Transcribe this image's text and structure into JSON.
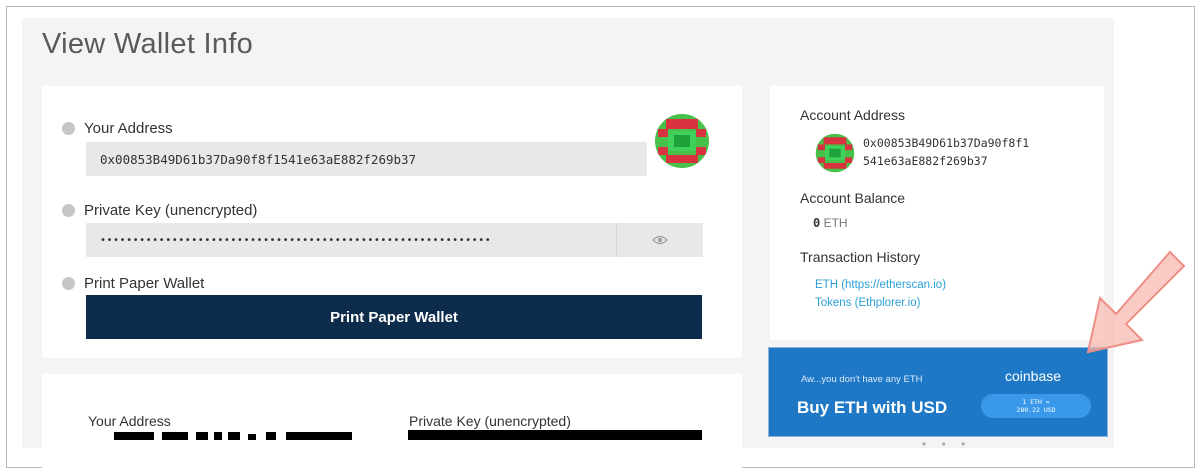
{
  "page": {
    "title": "View Wallet Info"
  },
  "wallet": {
    "your_address_label": "Your Address",
    "address_value": "0x00853B49D61b37Da90f8f1541e63aE882f269b37",
    "private_key_label": "Private Key (unencrypted)",
    "private_key_masked": "••••••••••••••••••••••••••••••••••••••••••••••••••••••••••••",
    "print_label": "Print Paper Wallet",
    "print_button": "Print Paper Wallet"
  },
  "account": {
    "address_label": "Account Address",
    "address_line1": "0x00853B49D61b37Da90f8f1",
    "address_line2": "541e63aE882f269b37",
    "balance_label": "Account Balance",
    "balance_amount": "0",
    "balance_unit": "ETH",
    "history_label": "Transaction History",
    "link_eth": "ETH (https://etherscan.io)",
    "link_tokens": "Tokens (Ethplorer.io)"
  },
  "coinbase": {
    "subtitle": "Aw...you don't have any ETH",
    "title": "Buy ETH with USD",
    "brand": "coinbase",
    "rate_line1": "1 ETH =",
    "rate_line2": "280.22 USD"
  },
  "paper": {
    "your_address_label": "Your Address",
    "private_key_label": "Private Key (unencrypted)"
  },
  "colors": {
    "navy_button": "#0d2b4a",
    "coinbase_blue": "#1f78c5",
    "link_blue": "#2a9fd6",
    "arrow": "#f7b9b2"
  },
  "icons": [
    "help-icon",
    "eye-icon",
    "identicon",
    "arrow-icon"
  ]
}
